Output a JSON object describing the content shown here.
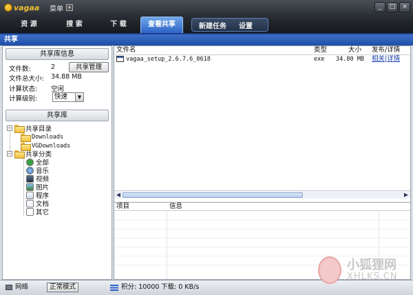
{
  "titlebar": {
    "logo_text": "vagaa",
    "menu_label": "菜单",
    "buttons": [
      "_",
      "□",
      "×"
    ]
  },
  "nav": {
    "tabs": [
      "资 源",
      "搜 索",
      "下 载",
      "查看共享"
    ],
    "active_tab": "查看共享",
    "group": [
      "新建任务",
      "设置"
    ]
  },
  "section": {
    "title": "共享"
  },
  "left": {
    "info_header": "共享库信息",
    "info": [
      {
        "label": "文件数:",
        "value": "2"
      },
      {
        "label": "文件总大小:",
        "value": "34.88 MB"
      },
      {
        "label": "计算状态:",
        "value": "空闲"
      },
      {
        "label": "计算级别:",
        "value": "快速"
      }
    ],
    "share_manage_button": "共享管理",
    "library_header": "共享库",
    "tree": {
      "dir_root": "共享目录",
      "dirs": [
        "Downloads",
        "VGDownloads"
      ],
      "cat_root": "共享分类",
      "categories": [
        "全部",
        "音乐",
        "视频",
        "图片",
        "程序",
        "文档",
        "其它"
      ]
    }
  },
  "files": {
    "columns": [
      "文件名",
      "类型",
      "大小",
      "发布/详情"
    ],
    "rows": [
      {
        "name": "vagaa_setup_2.6.7.6_0618",
        "type": "exe",
        "size": "34.80 MB",
        "detail": "相关|详情"
      }
    ]
  },
  "details": {
    "columns": [
      "项目",
      "信息"
    ]
  },
  "status": {
    "network": "网络",
    "mode": "正常模式",
    "points": "积分: 10000",
    "download": "下载: 0 KB/s"
  },
  "watermark": {
    "text": "小狐狸网",
    "sub": "XHLKS.CN"
  },
  "colors": {
    "accent": "#2c62c6",
    "header": "#1f4ea8",
    "link": "#1b3fb0"
  }
}
